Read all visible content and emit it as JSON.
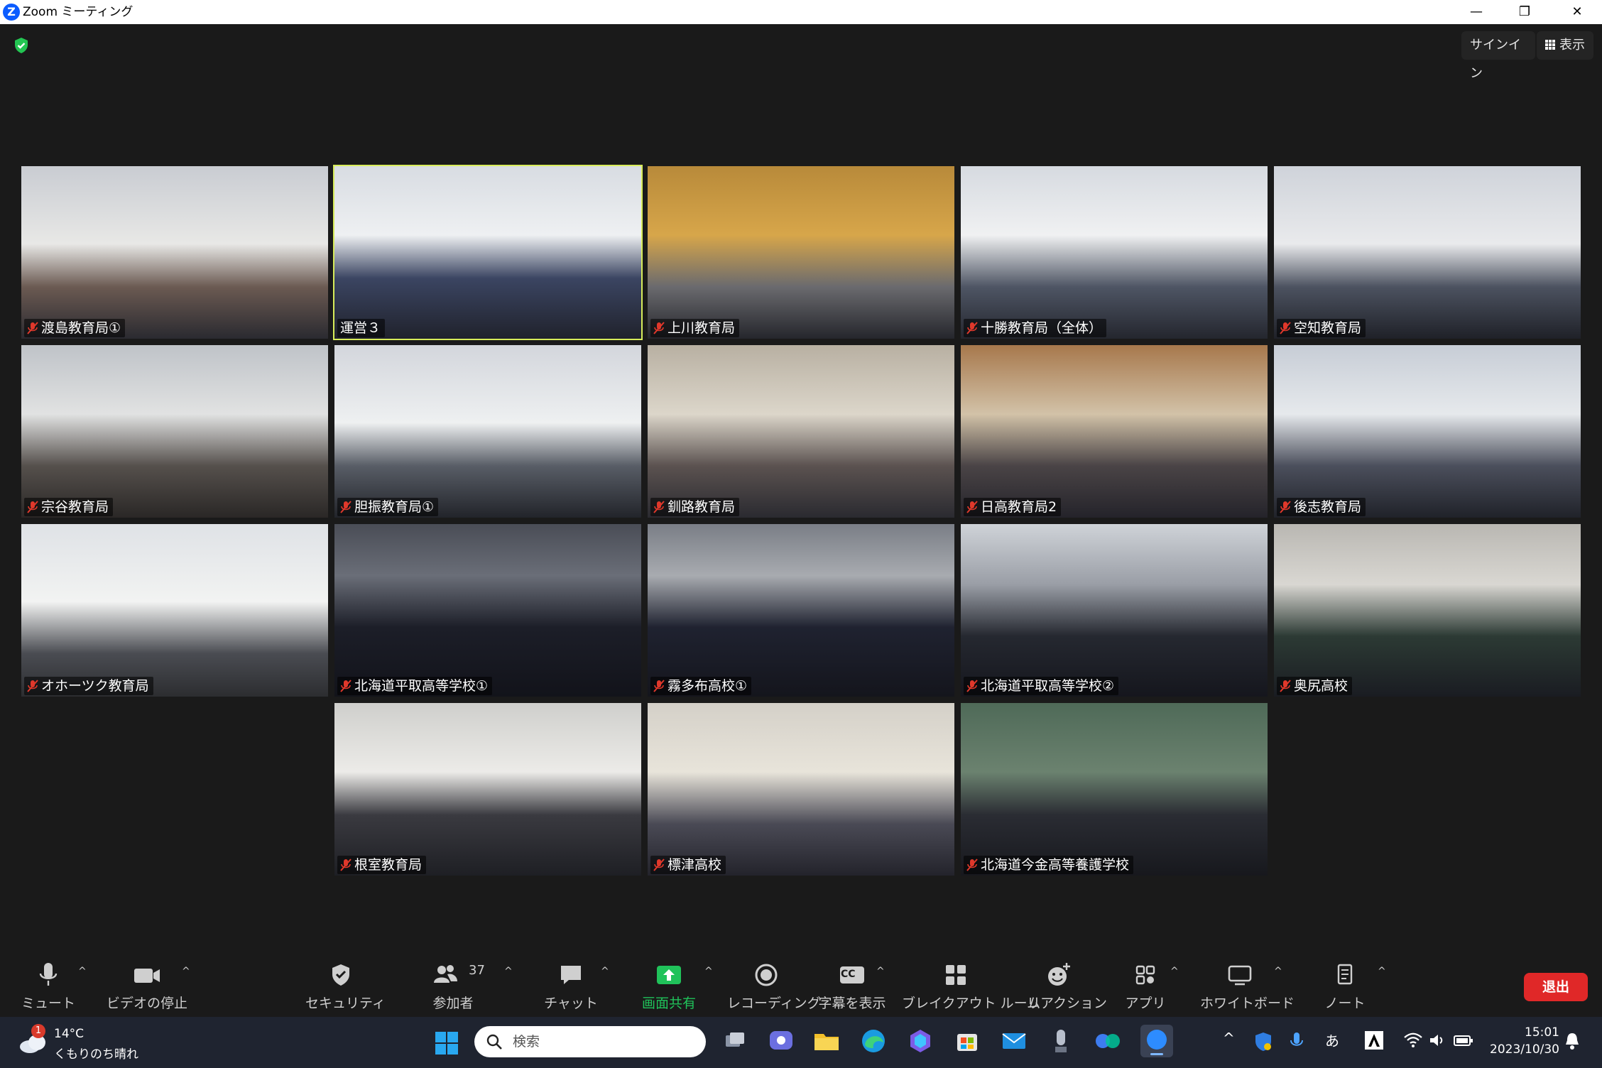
{
  "window": {
    "title": "Zoom ミーティング",
    "logo_letter": "Z",
    "minimize_glyph": "—",
    "maximize_glyph": "❐",
    "close_glyph": "✕"
  },
  "top": {
    "signin_label": "サインイン",
    "view_label": "表示"
  },
  "participants": [
    {
      "name": "渡島教育局",
      "suffix": "①",
      "muted": true,
      "active": false
    },
    {
      "name": "運営３",
      "suffix": "",
      "muted": false,
      "active": true
    },
    {
      "name": "上川教育局",
      "suffix": "",
      "muted": true,
      "active": false
    },
    {
      "name": "十勝教育局（全体）",
      "suffix": "",
      "muted": true,
      "active": false
    },
    {
      "name": "空知教育局",
      "suffix": "",
      "muted": true,
      "active": false
    },
    {
      "name": "宗谷教育局",
      "suffix": "",
      "muted": true,
      "active": false
    },
    {
      "name": "胆振教育局",
      "suffix": "①",
      "muted": true,
      "active": false
    },
    {
      "name": "釧路教育局",
      "suffix": "",
      "muted": true,
      "active": false
    },
    {
      "name": "日高教育局2",
      "suffix": "",
      "muted": true,
      "active": false
    },
    {
      "name": "後志教育局",
      "suffix": "",
      "muted": true,
      "active": false
    },
    {
      "name": "オホーツク教育局",
      "suffix": "",
      "muted": true,
      "active": false
    },
    {
      "name": "北海道平取高等学校",
      "suffix": "①",
      "muted": true,
      "active": false
    },
    {
      "name": "霧多布高校",
      "suffix": "①",
      "muted": true,
      "active": false
    },
    {
      "name": "北海道平取高等学校",
      "suffix": "②",
      "muted": true,
      "active": false
    },
    {
      "name": "奥尻高校",
      "suffix": "",
      "muted": true,
      "active": false
    },
    {
      "name": "根室教育局",
      "suffix": "",
      "muted": true,
      "active": false
    },
    {
      "name": "標津高校",
      "suffix": "",
      "muted": true,
      "active": false
    },
    {
      "name": "北海道今金高等養護学校",
      "suffix": "",
      "muted": true,
      "active": false
    }
  ],
  "toolbar": {
    "mute": "ミュート",
    "video": "ビデオの停止",
    "security": "セキュリティ",
    "participants": "参加者",
    "participants_count": "37",
    "chat": "チャット",
    "share": "画面共有",
    "record": "レコーディング",
    "captions": "字幕を表示",
    "captions_badge": "CC",
    "breakout": "ブレイクアウト ルーム",
    "reactions": "リアクション",
    "apps": "アプリ",
    "whiteboard": "ホワイトボード",
    "notes": "ノート",
    "leave": "退出",
    "caret": "^"
  },
  "taskbar": {
    "weather_temp": "14°C",
    "weather_cond": "くもりのち晴れ",
    "weather_badge": "1",
    "search_placeholder": "検索",
    "tray_chevron": "^",
    "tray_ime": "あ",
    "time": "15:01",
    "date": "2023/10/30"
  },
  "colors": {
    "accent_green": "#20c25a",
    "active_outline": "#d7ec5a",
    "leave_red": "#e02828",
    "muted_red": "#e0382b"
  }
}
